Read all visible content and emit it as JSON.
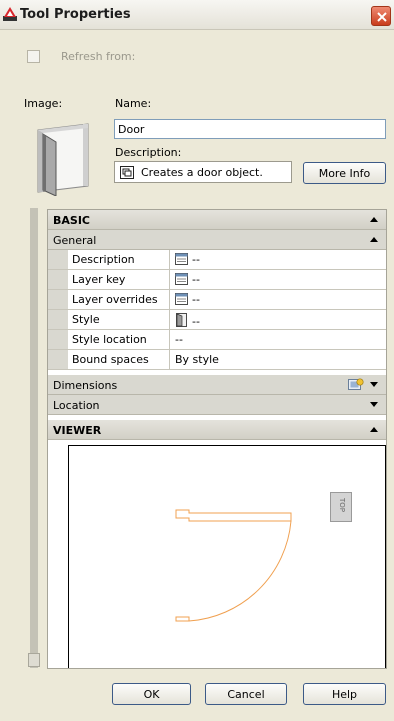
{
  "window": {
    "title": "Tool Properties",
    "close_icon": "close-icon"
  },
  "refresh": {
    "label": "Refresh from:",
    "checked": false
  },
  "header": {
    "image_label": "Image:",
    "name_label": "Name:",
    "name_value": "Door",
    "description_label": "Description:",
    "description_value": "Creates a door object.",
    "more_info_label": "More Info"
  },
  "grid": {
    "basic": {
      "label": "BASIC",
      "general": {
        "label": "General",
        "rows": [
          {
            "name": "Description",
            "value": "--",
            "icon": "list-icon"
          },
          {
            "name": "Layer key",
            "value": "--",
            "icon": "list-icon"
          },
          {
            "name": "Layer overrides",
            "value": "--",
            "icon": "list-icon"
          },
          {
            "name": "Style",
            "value": "--",
            "icon": "door-style-icon"
          },
          {
            "name": "Style location",
            "value": "--"
          },
          {
            "name": "Bound spaces",
            "value": "By style"
          }
        ]
      },
      "dimensions": {
        "label": "Dimensions"
      },
      "location": {
        "label": "Location"
      }
    },
    "viewer": {
      "label": "VIEWER",
      "cube_label": "TOP"
    }
  },
  "buttons": {
    "ok": "OK",
    "cancel": "Cancel",
    "help": "Help"
  },
  "colors": {
    "door_preview": "#f0a050",
    "close_button": "#d0502c"
  }
}
